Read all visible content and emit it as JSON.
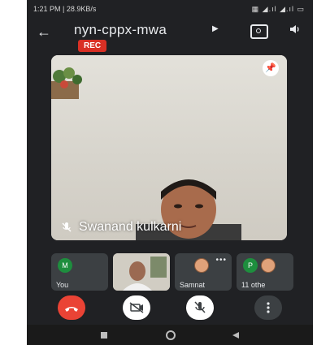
{
  "status_bar": {
    "time_speed": "1:21 PM | 28.9KB/s",
    "icons": "▦ ◢.ıl ◢.ıl ▭"
  },
  "header": {
    "meeting_code": "nyn-cppx-mwa",
    "rec_badge": "REC"
  },
  "main_tile": {
    "speaker_name": "Swanand kulkarni"
  },
  "thumbnails": [
    {
      "label": "You",
      "avatar_letter": "M"
    },
    {
      "label": ""
    },
    {
      "label": "Samnat"
    },
    {
      "label": "11 othe",
      "avatar_letter": "P"
    }
  ],
  "colors": {
    "background": "#202124",
    "rec": "#d93025",
    "end_call": "#ea4335",
    "avatar_green": "#1e8e3e"
  },
  "icons": [
    "back-arrow-icon",
    "switch-camera-icon",
    "speaker-icon",
    "pin-icon",
    "mic-off-icon",
    "end-call-icon",
    "camera-off-icon",
    "more-options-icon",
    "nav-recent-icon",
    "nav-home-icon",
    "nav-back-icon"
  ]
}
